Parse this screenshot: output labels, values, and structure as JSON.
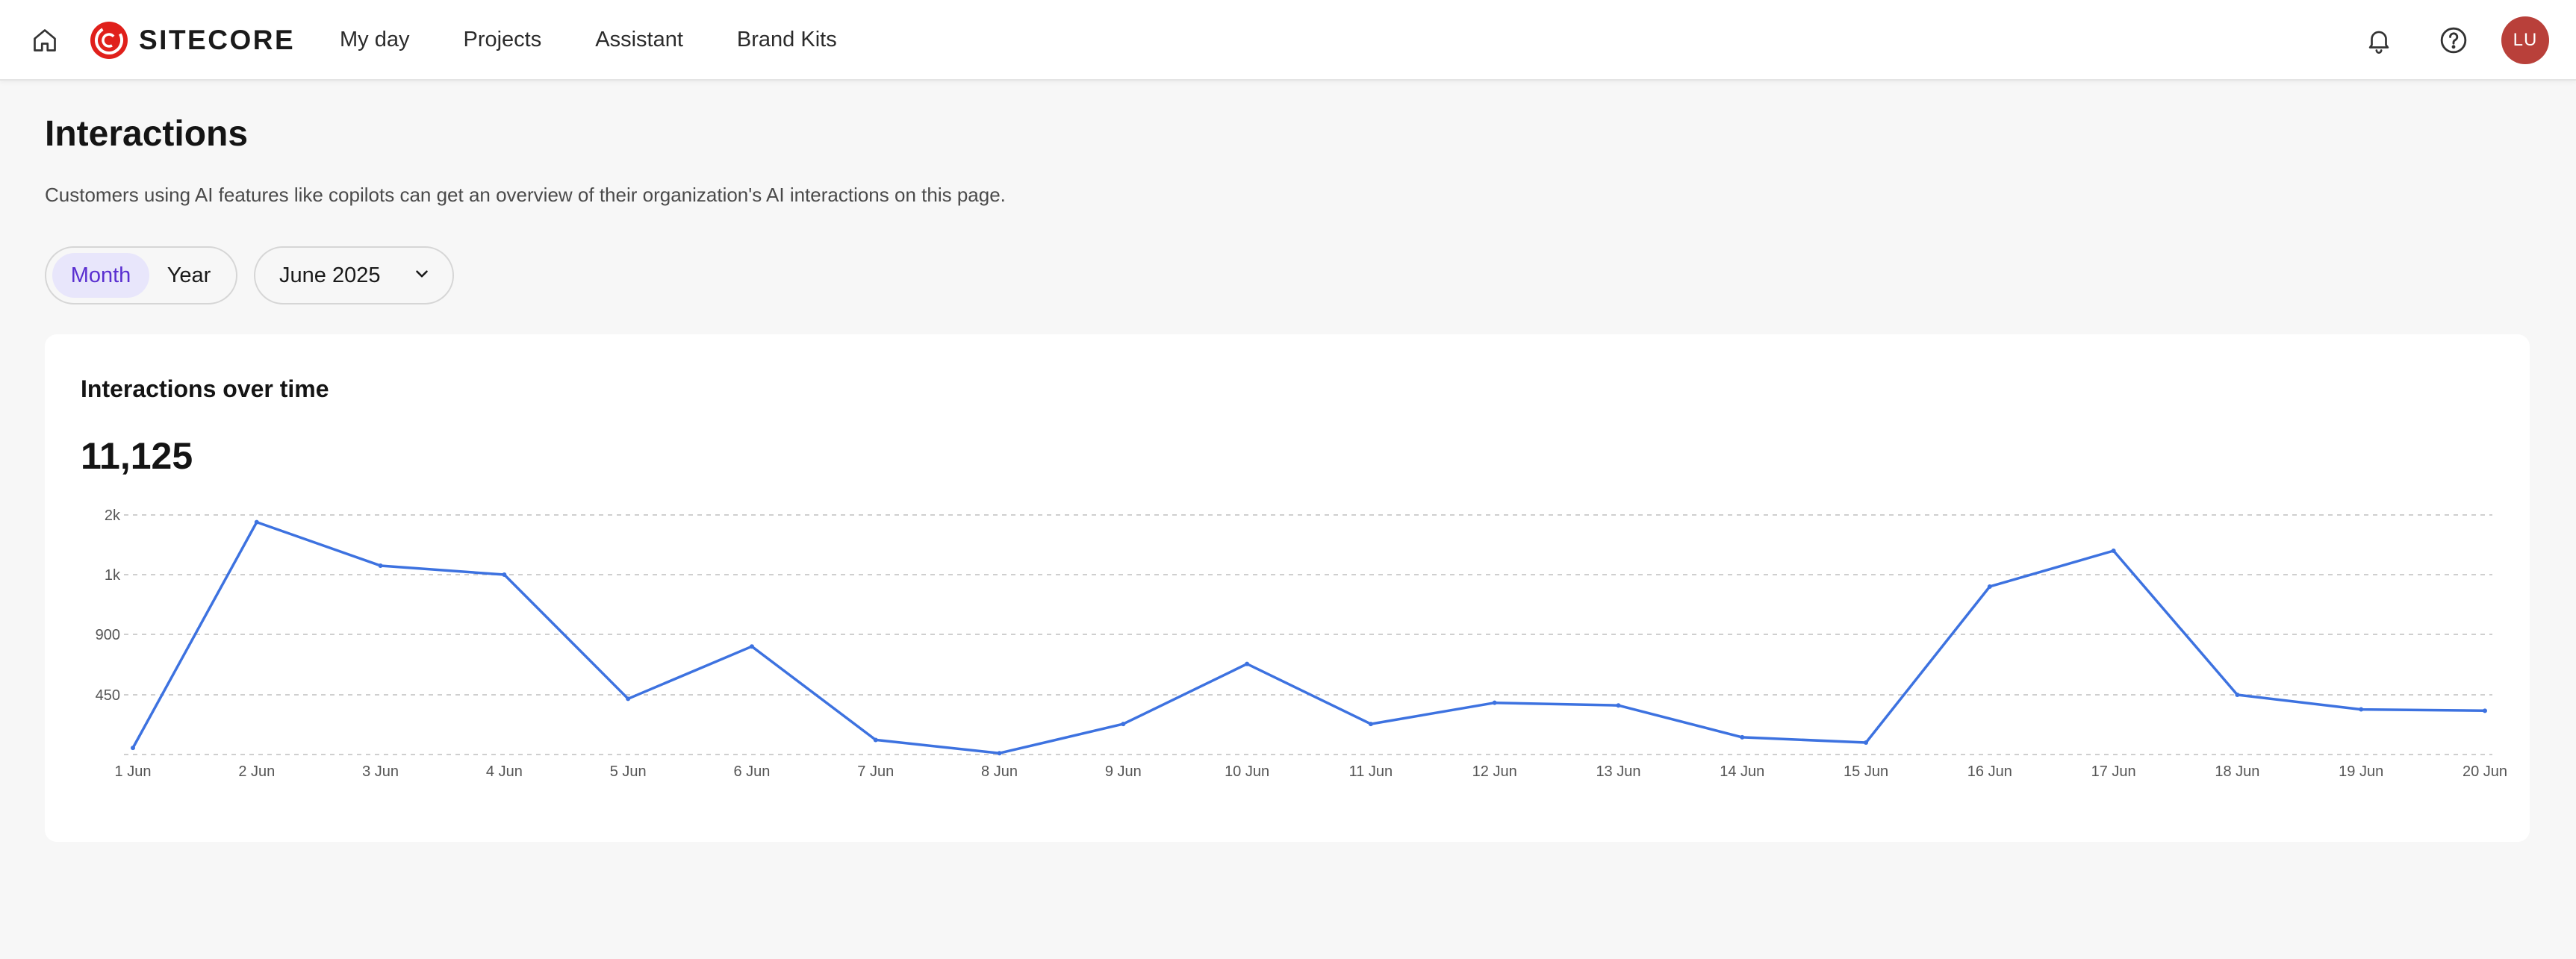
{
  "nav": {
    "brand": "SITECORE",
    "items": [
      "My day",
      "Projects",
      "Assistant",
      "Brand Kits"
    ],
    "avatar_initials": "LU"
  },
  "page": {
    "title": "Interactions",
    "description": "Customers using AI features like copilots can get an overview of their organization's AI interactions on this page."
  },
  "filters": {
    "period_options": [
      "Month",
      "Year"
    ],
    "selected_period": "Month",
    "date_value": "June 2025"
  },
  "card": {
    "title": "Interactions over time",
    "total": "11,125"
  },
  "colors": {
    "line": "#3d72e0",
    "accent": "#5a2fd0",
    "brand_red": "#e0201b",
    "avatar": "#b9403a"
  },
  "chart_data": {
    "type": "line",
    "x": [
      "1 Jun",
      "2 Jun",
      "3 Jun",
      "4 Jun",
      "5 Jun",
      "6 Jun",
      "7 Jun",
      "8 Jun",
      "9 Jun",
      "10 Jun",
      "11 Jun",
      "12 Jun",
      "13 Jun",
      "14 Jun",
      "15 Jun",
      "16 Jun",
      "17 Jun",
      "18 Jun",
      "19 Jun",
      "20 Jun"
    ],
    "y_tick_labels": [
      "2k",
      "1k",
      "900",
      "450"
    ],
    "y_tick_values": [
      2000,
      1000,
      900,
      450,
      0
    ],
    "scale": "categorical",
    "values": [
      50,
      1880,
      1150,
      1000,
      420,
      810,
      110,
      10,
      230,
      680,
      230,
      390,
      370,
      130,
      90,
      980,
      1400,
      450,
      340,
      330
    ],
    "grid": true,
    "legend": "none"
  }
}
